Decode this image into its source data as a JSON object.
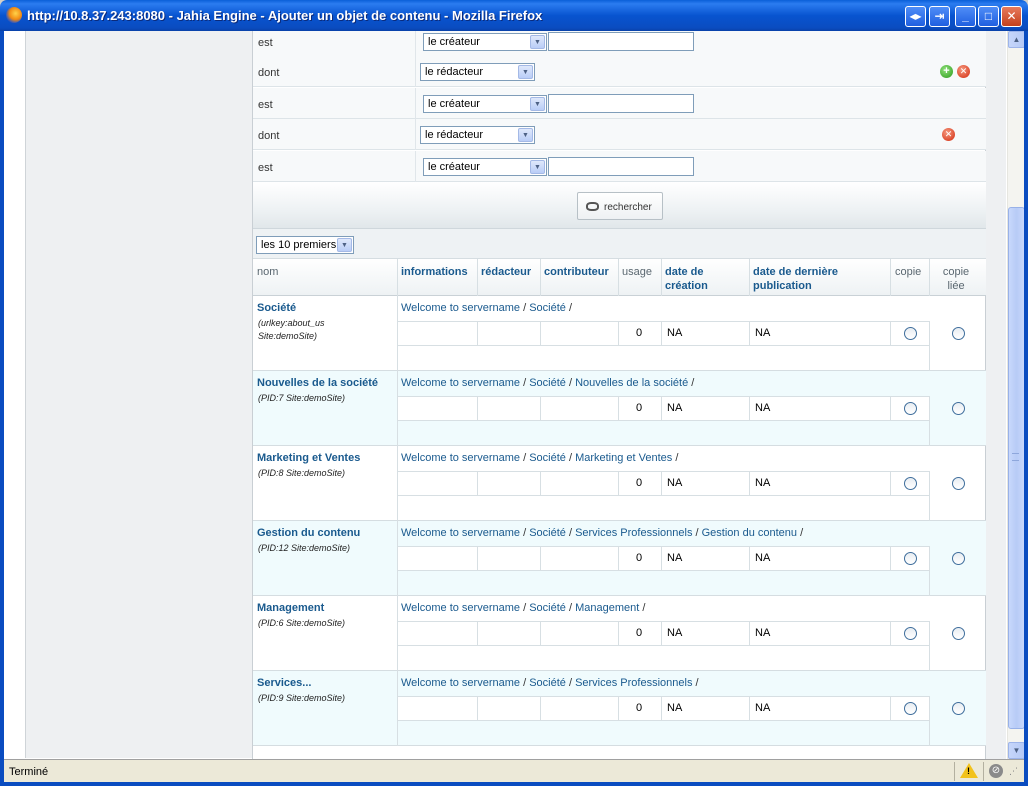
{
  "window": {
    "title": "http://10.8.37.243:8080 - Jahia Engine - Ajouter un objet de contenu - Mozilla Firefox",
    "buttons": {
      "restore": "◂▸",
      "popout": "⇥",
      "minimize": "_",
      "maximize": "□",
      "close": "✕"
    }
  },
  "criteria": [
    {
      "label": "est",
      "select": "le créateur",
      "has_text": true,
      "icons": []
    },
    {
      "label": "dont",
      "select": "le rédacteur",
      "has_text": false,
      "icons": [
        "add",
        "delete"
      ]
    },
    {
      "label": "est",
      "select": "le créateur",
      "has_text": true,
      "icons": []
    },
    {
      "label": "dont",
      "select": "le rédacteur",
      "has_text": false,
      "icons": [
        "delete"
      ]
    },
    {
      "label": "est",
      "select": "le créateur",
      "has_text": true,
      "icons": []
    }
  ],
  "search_button": "rechercher",
  "pager_select": "les 10 premiers",
  "table": {
    "headers": {
      "nom": "nom",
      "informations": "informations",
      "redacteur": "rédacteur",
      "contributeur": "contributeur",
      "usage": "usage",
      "date_creation": "date de création",
      "date_publication": "date de dernière publication",
      "copie": "copie",
      "copie_liee": "copie liée"
    },
    "rows": [
      {
        "name": "Société",
        "meta1": "(urlkey:about_us",
        "meta2": "Site:demoSite)",
        "path": [
          "Welcome to servername",
          "Société"
        ],
        "usage": "0",
        "creation": "NA",
        "publication": "NA"
      },
      {
        "name": "Nouvelles de la société",
        "meta1": "(PID:7 Site:demoSite)",
        "meta2": "",
        "path": [
          "Welcome to servername",
          "Société",
          "Nouvelles de la société"
        ],
        "usage": "0",
        "creation": "NA",
        "publication": "NA"
      },
      {
        "name": "Marketing et Ventes",
        "meta1": "(PID:8 Site:demoSite)",
        "meta2": "",
        "path": [
          "Welcome to servername",
          "Société",
          "Marketing et Ventes"
        ],
        "usage": "0",
        "creation": "NA",
        "publication": "NA"
      },
      {
        "name": "Gestion du contenu",
        "meta1": "(PID:12 Site:demoSite)",
        "meta2": "",
        "path": [
          "Welcome to servername",
          "Société",
          "Services Professionnels",
          "Gestion du contenu"
        ],
        "usage": "0",
        "creation": "NA",
        "publication": "NA"
      },
      {
        "name": "Management",
        "meta1": "(PID:6 Site:demoSite)",
        "meta2": "",
        "path": [
          "Welcome to servername",
          "Société",
          "Management"
        ],
        "usage": "0",
        "creation": "NA",
        "publication": "NA"
      },
      {
        "name": "Services...",
        "meta1": "(PID:9 Site:demoSite)",
        "meta2": "",
        "path": [
          "Welcome to servername",
          "Société",
          "Services Professionnels"
        ],
        "usage": "0",
        "creation": "NA",
        "publication": "NA"
      }
    ]
  },
  "status": {
    "text": "Terminé",
    "warning_icon": "warning-icon",
    "noentry_icon": "no-entry-icon"
  }
}
